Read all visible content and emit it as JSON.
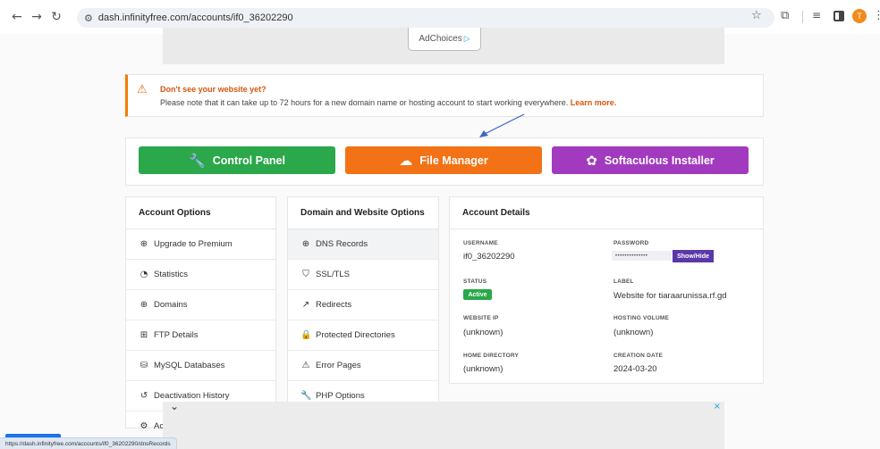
{
  "browser": {
    "url": "dash.infinityfree.com/accounts/if0_36202290",
    "profile_initial": "T",
    "icons": [
      "back-arrow-icon",
      "forward-arrow-icon",
      "reload-icon",
      "site-settings-icon",
      "star-icon",
      "extensions-icon",
      "reading-list-icon",
      "side-panel-icon",
      "kebab-menu-icon"
    ]
  },
  "ad_top": {
    "adchoices": "AdChoices"
  },
  "alert": {
    "title": "Don't see your website yet?",
    "message": "Please note that it can take up to 72 hours for a new domain name or hosting account to start working everywhere.",
    "link": "Learn more."
  },
  "buttons": {
    "control_panel": "Control Panel",
    "file_manager": "File Manager",
    "softaculous": "Softaculous Installer"
  },
  "colors": {
    "control_panel": "#2aa84a",
    "file_manager": "#f37216",
    "softaculous": "#a23ac0",
    "accent_orange": "#f57c00",
    "show_hide": "#5a38a8"
  },
  "account_options": {
    "title": "Account Options",
    "items": [
      {
        "label": "Upgrade to Premium",
        "icon": "upgrade-icon"
      },
      {
        "label": "Statistics",
        "icon": "statistics-icon"
      },
      {
        "label": "Domains",
        "icon": "globe-icon"
      },
      {
        "label": "FTP Details",
        "icon": "ftp-icon"
      },
      {
        "label": "MySQL Databases",
        "icon": "database-icon"
      },
      {
        "label": "Deactivation History",
        "icon": "history-icon"
      },
      {
        "label": "Acc",
        "icon": "gear-icon"
      }
    ]
  },
  "domain_options": {
    "title": "Domain and Website Options",
    "items": [
      {
        "label": "DNS Records",
        "icon": "dns-icon"
      },
      {
        "label": "SSL/TLS",
        "icon": "shield-icon"
      },
      {
        "label": "Redirects",
        "icon": "redirect-icon"
      },
      {
        "label": "Protected Directories",
        "icon": "lock-icon"
      },
      {
        "label": "Error Pages",
        "icon": "warning-icon"
      },
      {
        "label": "PHP Options",
        "icon": "wrench-icon"
      }
    ]
  },
  "account_details": {
    "title": "Account Details",
    "username_label": "USERNAME",
    "username": "if0_36202290",
    "password_label": "PASSWORD",
    "password_mask": "••••••••••••••",
    "show_hide": "Show/Hide",
    "status_label": "STATUS",
    "status": "Active",
    "label_label": "LABEL",
    "label": "Website for tiaraarunissa.rf.gd",
    "website_ip_label": "WEBSITE IP",
    "website_ip": "(unknown)",
    "hosting_volume_label": "HOSTING VOLUME",
    "hosting_volume": "(unknown)",
    "home_directory_label": "HOME DIRECTORY",
    "home_directory": "(unknown)",
    "creation_date_label": "CREATION DATE",
    "creation_date": "2024-03-20"
  },
  "ad_bottom": {
    "close": "×"
  },
  "statusbar": {
    "url": "https://dash.infinityfree.com/accounts/if0_36202290/dnsRecords"
  }
}
